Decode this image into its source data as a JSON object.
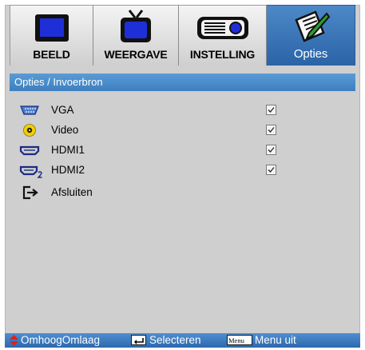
{
  "tabs": [
    {
      "label": "BEELD",
      "icon": "monitor-icon",
      "active": false
    },
    {
      "label": "WEERGAVE",
      "icon": "tv-icon",
      "active": false
    },
    {
      "label": "INSTELLING",
      "icon": "projector-icon",
      "active": false
    },
    {
      "label": "Opties",
      "icon": "notepad-pen-icon",
      "active": true
    }
  ],
  "section": {
    "title": "Opties / Invoerbron"
  },
  "items": [
    {
      "label": "VGA",
      "icon": "vga-port-icon",
      "checked": true
    },
    {
      "label": "Video",
      "icon": "video-rca-icon",
      "checked": true
    },
    {
      "label": "HDMI1",
      "icon": "hdmi-port-icon",
      "checked": true
    },
    {
      "label": "HDMI2",
      "icon": "hdmi2-port-icon",
      "checked": true
    },
    {
      "label": "Afsluiten",
      "icon": "exit-icon",
      "checked": null
    }
  ],
  "bottom_bar": {
    "navigate_label": "OmhoogOmlaag",
    "select_label": "Selecteren",
    "menu_key": "Menu",
    "menu_label": "Menu uit"
  },
  "colors": {
    "accent_blue": "#3d7fbf",
    "panel_gray": "#cfcfcf",
    "nav_arrow_red": "#e0201c",
    "video_icon_yellow": "#f2d000"
  }
}
